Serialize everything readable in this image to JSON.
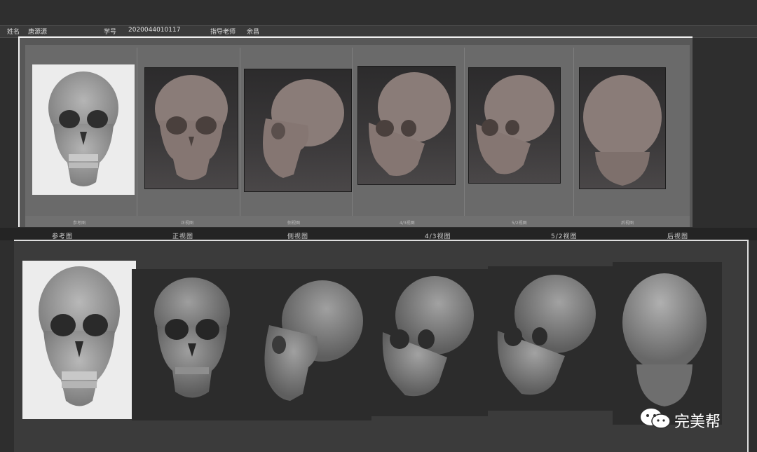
{
  "info": {
    "name_label": "姓名",
    "name_value": "唐源源",
    "id_label": "学号",
    "id_value": "2020044010117",
    "teacher_label": "指导老师",
    "teacher_value": "余昌"
  },
  "views": {
    "reference": "参考图",
    "front": "正视图",
    "side": "侧视图",
    "three_quarter": "4/3视图",
    "five_half": "5/2视图",
    "back": "后视图"
  },
  "watermark": {
    "text": "完美帮",
    "icon": "wechat-icon"
  },
  "colors": {
    "background": "#2e2e2e",
    "skull_clay_brown": "#8a7a76",
    "skull_gray": "#8e8e8e"
  }
}
